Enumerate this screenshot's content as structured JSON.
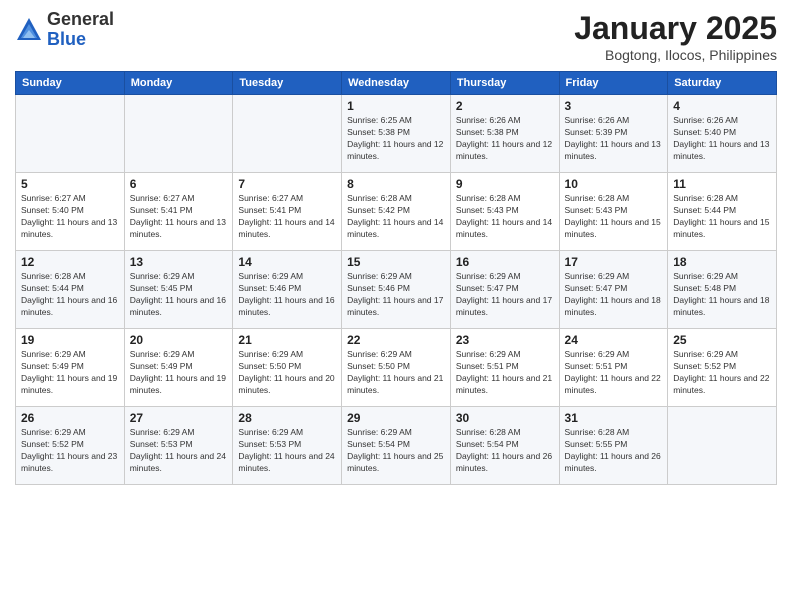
{
  "logo": {
    "general": "General",
    "blue": "Blue"
  },
  "header": {
    "month": "January 2025",
    "location": "Bogtong, Ilocos, Philippines"
  },
  "weekdays": [
    "Sunday",
    "Monday",
    "Tuesday",
    "Wednesday",
    "Thursday",
    "Friday",
    "Saturday"
  ],
  "weeks": [
    [
      {
        "day": "",
        "sunrise": "",
        "sunset": "",
        "daylight": ""
      },
      {
        "day": "",
        "sunrise": "",
        "sunset": "",
        "daylight": ""
      },
      {
        "day": "",
        "sunrise": "",
        "sunset": "",
        "daylight": ""
      },
      {
        "day": "1",
        "sunrise": "Sunrise: 6:25 AM",
        "sunset": "Sunset: 5:38 PM",
        "daylight": "Daylight: 11 hours and 12 minutes."
      },
      {
        "day": "2",
        "sunrise": "Sunrise: 6:26 AM",
        "sunset": "Sunset: 5:38 PM",
        "daylight": "Daylight: 11 hours and 12 minutes."
      },
      {
        "day": "3",
        "sunrise": "Sunrise: 6:26 AM",
        "sunset": "Sunset: 5:39 PM",
        "daylight": "Daylight: 11 hours and 13 minutes."
      },
      {
        "day": "4",
        "sunrise": "Sunrise: 6:26 AM",
        "sunset": "Sunset: 5:40 PM",
        "daylight": "Daylight: 11 hours and 13 minutes."
      }
    ],
    [
      {
        "day": "5",
        "sunrise": "Sunrise: 6:27 AM",
        "sunset": "Sunset: 5:40 PM",
        "daylight": "Daylight: 11 hours and 13 minutes."
      },
      {
        "day": "6",
        "sunrise": "Sunrise: 6:27 AM",
        "sunset": "Sunset: 5:41 PM",
        "daylight": "Daylight: 11 hours and 13 minutes."
      },
      {
        "day": "7",
        "sunrise": "Sunrise: 6:27 AM",
        "sunset": "Sunset: 5:41 PM",
        "daylight": "Daylight: 11 hours and 14 minutes."
      },
      {
        "day": "8",
        "sunrise": "Sunrise: 6:28 AM",
        "sunset": "Sunset: 5:42 PM",
        "daylight": "Daylight: 11 hours and 14 minutes."
      },
      {
        "day": "9",
        "sunrise": "Sunrise: 6:28 AM",
        "sunset": "Sunset: 5:43 PM",
        "daylight": "Daylight: 11 hours and 14 minutes."
      },
      {
        "day": "10",
        "sunrise": "Sunrise: 6:28 AM",
        "sunset": "Sunset: 5:43 PM",
        "daylight": "Daylight: 11 hours and 15 minutes."
      },
      {
        "day": "11",
        "sunrise": "Sunrise: 6:28 AM",
        "sunset": "Sunset: 5:44 PM",
        "daylight": "Daylight: 11 hours and 15 minutes."
      }
    ],
    [
      {
        "day": "12",
        "sunrise": "Sunrise: 6:28 AM",
        "sunset": "Sunset: 5:44 PM",
        "daylight": "Daylight: 11 hours and 16 minutes."
      },
      {
        "day": "13",
        "sunrise": "Sunrise: 6:29 AM",
        "sunset": "Sunset: 5:45 PM",
        "daylight": "Daylight: 11 hours and 16 minutes."
      },
      {
        "day": "14",
        "sunrise": "Sunrise: 6:29 AM",
        "sunset": "Sunset: 5:46 PM",
        "daylight": "Daylight: 11 hours and 16 minutes."
      },
      {
        "day": "15",
        "sunrise": "Sunrise: 6:29 AM",
        "sunset": "Sunset: 5:46 PM",
        "daylight": "Daylight: 11 hours and 17 minutes."
      },
      {
        "day": "16",
        "sunrise": "Sunrise: 6:29 AM",
        "sunset": "Sunset: 5:47 PM",
        "daylight": "Daylight: 11 hours and 17 minutes."
      },
      {
        "day": "17",
        "sunrise": "Sunrise: 6:29 AM",
        "sunset": "Sunset: 5:47 PM",
        "daylight": "Daylight: 11 hours and 18 minutes."
      },
      {
        "day": "18",
        "sunrise": "Sunrise: 6:29 AM",
        "sunset": "Sunset: 5:48 PM",
        "daylight": "Daylight: 11 hours and 18 minutes."
      }
    ],
    [
      {
        "day": "19",
        "sunrise": "Sunrise: 6:29 AM",
        "sunset": "Sunset: 5:49 PM",
        "daylight": "Daylight: 11 hours and 19 minutes."
      },
      {
        "day": "20",
        "sunrise": "Sunrise: 6:29 AM",
        "sunset": "Sunset: 5:49 PM",
        "daylight": "Daylight: 11 hours and 19 minutes."
      },
      {
        "day": "21",
        "sunrise": "Sunrise: 6:29 AM",
        "sunset": "Sunset: 5:50 PM",
        "daylight": "Daylight: 11 hours and 20 minutes."
      },
      {
        "day": "22",
        "sunrise": "Sunrise: 6:29 AM",
        "sunset": "Sunset: 5:50 PM",
        "daylight": "Daylight: 11 hours and 21 minutes."
      },
      {
        "day": "23",
        "sunrise": "Sunrise: 6:29 AM",
        "sunset": "Sunset: 5:51 PM",
        "daylight": "Daylight: 11 hours and 21 minutes."
      },
      {
        "day": "24",
        "sunrise": "Sunrise: 6:29 AM",
        "sunset": "Sunset: 5:51 PM",
        "daylight": "Daylight: 11 hours and 22 minutes."
      },
      {
        "day": "25",
        "sunrise": "Sunrise: 6:29 AM",
        "sunset": "Sunset: 5:52 PM",
        "daylight": "Daylight: 11 hours and 22 minutes."
      }
    ],
    [
      {
        "day": "26",
        "sunrise": "Sunrise: 6:29 AM",
        "sunset": "Sunset: 5:52 PM",
        "daylight": "Daylight: 11 hours and 23 minutes."
      },
      {
        "day": "27",
        "sunrise": "Sunrise: 6:29 AM",
        "sunset": "Sunset: 5:53 PM",
        "daylight": "Daylight: 11 hours and 24 minutes."
      },
      {
        "day": "28",
        "sunrise": "Sunrise: 6:29 AM",
        "sunset": "Sunset: 5:53 PM",
        "daylight": "Daylight: 11 hours and 24 minutes."
      },
      {
        "day": "29",
        "sunrise": "Sunrise: 6:29 AM",
        "sunset": "Sunset: 5:54 PM",
        "daylight": "Daylight: 11 hours and 25 minutes."
      },
      {
        "day": "30",
        "sunrise": "Sunrise: 6:28 AM",
        "sunset": "Sunset: 5:54 PM",
        "daylight": "Daylight: 11 hours and 26 minutes."
      },
      {
        "day": "31",
        "sunrise": "Sunrise: 6:28 AM",
        "sunset": "Sunset: 5:55 PM",
        "daylight": "Daylight: 11 hours and 26 minutes."
      },
      {
        "day": "",
        "sunrise": "",
        "sunset": "",
        "daylight": ""
      }
    ]
  ]
}
